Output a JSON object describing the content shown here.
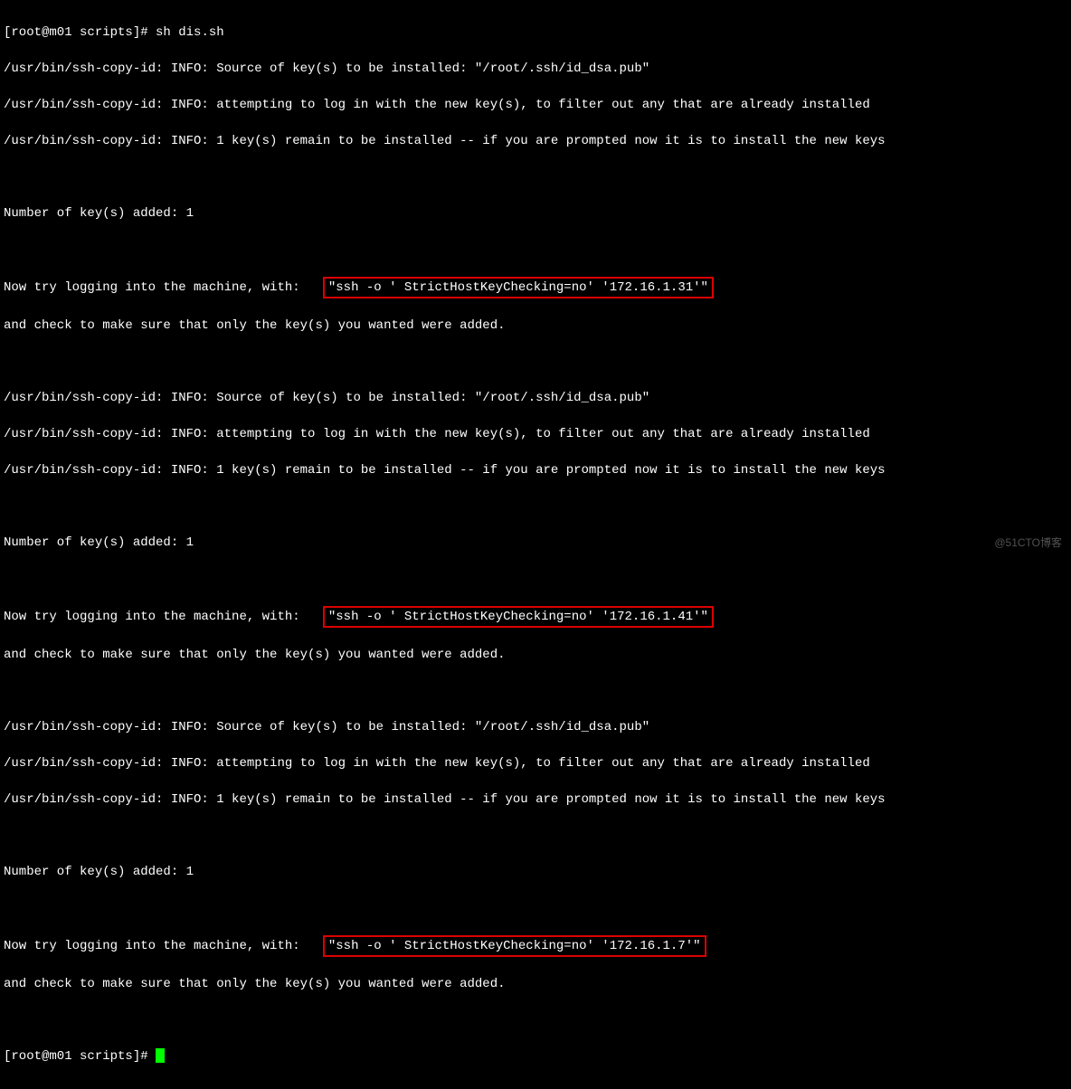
{
  "prompt1_user": "[root@m01 scripts]# ",
  "prompt1_cmd": "sh dis.sh",
  "block1_l1": "/usr/bin/ssh-copy-id: INFO: Source of key(s) to be installed: \"/root/.ssh/id_dsa.pub\"",
  "block1_l2": "/usr/bin/ssh-copy-id: INFO: attempting to log in with the new key(s), to filter out any that are already installed",
  "block1_l3": "/usr/bin/ssh-copy-id: INFO: 1 key(s) remain to be installed -- if you are prompted now it is to install the new keys",
  "block1_added": "Number of key(s) added: 1",
  "block1_try_pre": "Now try logging into the machine, with:   ",
  "block1_try_hl": "\"ssh -o ' StrictHostKeyChecking=no' '172.16.1.31'\"",
  "block1_check": "and check to make sure that only the key(s) you wanted were added.",
  "block2_l1": "/usr/bin/ssh-copy-id: INFO: Source of key(s) to be installed: \"/root/.ssh/id_dsa.pub\"",
  "block2_l2": "/usr/bin/ssh-copy-id: INFO: attempting to log in with the new key(s), to filter out any that are already installed",
  "block2_l3": "/usr/bin/ssh-copy-id: INFO: 1 key(s) remain to be installed -- if you are prompted now it is to install the new keys",
  "block2_added": "Number of key(s) added: 1",
  "block2_try_pre": "Now try logging into the machine, with:   ",
  "block2_try_hl": "\"ssh -o ' StrictHostKeyChecking=no' '172.16.1.41'\"",
  "block2_check": "and check to make sure that only the key(s) you wanted were added.",
  "block3_l1": "/usr/bin/ssh-copy-id: INFO: Source of key(s) to be installed: \"/root/.ssh/id_dsa.pub\"",
  "block3_l2": "/usr/bin/ssh-copy-id: INFO: attempting to log in with the new key(s), to filter out any that are already installed",
  "block3_l3": "/usr/bin/ssh-copy-id: INFO: 1 key(s) remain to be installed -- if you are prompted now it is to install the new keys",
  "block3_added": "Number of key(s) added: 1",
  "block3_try_pre": "Now try logging into the machine, with:   ",
  "block3_try_hl": "\"ssh -o ' StrictHostKeyChecking=no' '172.16.1.7'\"",
  "block3_check": "and check to make sure that only the key(s) you wanted were added.",
  "prompt2": "[root@m01 scripts]# ",
  "watermark": "@51CTO博客"
}
